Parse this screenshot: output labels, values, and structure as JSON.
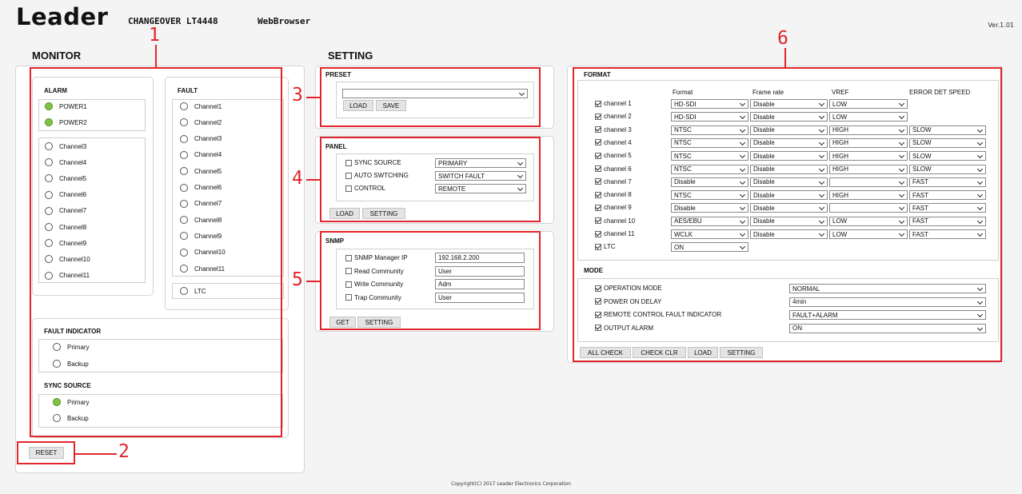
{
  "header": {
    "logo": "Leader",
    "product": "CHANGEOVER LT4448",
    "app": "WebBrowser",
    "version": "Ver.1.01"
  },
  "monitor": {
    "title": "MONITOR",
    "alarm": {
      "title": "ALARM",
      "power": [
        {
          "label": "POWER1",
          "on": true
        },
        {
          "label": "POWER2",
          "on": true
        }
      ],
      "channels": [
        "Channel3",
        "Channel4",
        "Channel5",
        "Channel6",
        "Channel7",
        "Channel8",
        "Channel9",
        "Channel10",
        "Channel11"
      ]
    },
    "fault": {
      "title": "FAULT",
      "channels": [
        "Channel1",
        "Channel2",
        "Channel3",
        "Channel4",
        "Channel5",
        "Channel6",
        "Channel7",
        "Channel8",
        "Channel9",
        "Channel10",
        "Channel11"
      ],
      "ltc": "LTC"
    },
    "fault_indicator": {
      "title": "FAULT INDICATOR",
      "items": [
        {
          "label": "Primary",
          "on": false
        },
        {
          "label": "Backup",
          "on": false
        }
      ]
    },
    "sync_source": {
      "title": "SYNC SOURCE",
      "items": [
        {
          "label": "Primary",
          "on": true
        },
        {
          "label": "Backup",
          "on": false
        }
      ]
    },
    "reset": "RESET"
  },
  "setting": {
    "title": "SETTING",
    "preset": {
      "title": "PRESET",
      "value": "",
      "load": "LOAD",
      "save": "SAVE"
    },
    "panel": {
      "title": "PANEL",
      "rows": [
        {
          "label": "SYNC SOURCE",
          "value": "PRIMARY"
        },
        {
          "label": "AUTO SWTCHING",
          "value": "SWITCH FAULT"
        },
        {
          "label": "CONTROL",
          "value": "REMOTE"
        }
      ],
      "load": "LOAD",
      "setting": "SETTING"
    },
    "snmp": {
      "title": "SNMP",
      "rows": [
        {
          "label": "SNMP Manager IP",
          "value": "192.168.2.200"
        },
        {
          "label": "Read Community",
          "value": "User"
        },
        {
          "label": "Write Community",
          "value": "Adm"
        },
        {
          "label": "Trap Community",
          "value": "User"
        }
      ],
      "get": "GET",
      "setting": "SETTING"
    }
  },
  "format": {
    "title": "FORMAT",
    "columns": [
      "Format",
      "Frame rate",
      "VREF",
      "ERROR DET SPEED"
    ],
    "rows": [
      {
        "label": "channel 1",
        "format": "HD-SDI",
        "frame": "Disable",
        "vref": "LOW",
        "speed": null
      },
      {
        "label": "channel 2",
        "format": "HD-SDI",
        "frame": "Disable",
        "vref": "LOW",
        "speed": null
      },
      {
        "label": "channel 3",
        "format": "NTSC",
        "frame": "Disable",
        "vref": "HIGH",
        "speed": "SLOW"
      },
      {
        "label": "channel 4",
        "format": "NTSC",
        "frame": "Disable",
        "vref": "HIGH",
        "speed": "SLOW"
      },
      {
        "label": "channel 5",
        "format": "NTSC",
        "frame": "Disable",
        "vref": "HIGH",
        "speed": "SLOW"
      },
      {
        "label": "channel 6",
        "format": "NTSC",
        "frame": "Disable",
        "vref": "HIGH",
        "speed": "SLOW"
      },
      {
        "label": "channel 7",
        "format": "Disable",
        "frame": "Disable",
        "vref": "",
        "speed": "FAST"
      },
      {
        "label": "channel 8",
        "format": "NTSC",
        "frame": "Disable",
        "vref": "HIGH",
        "speed": "FAST"
      },
      {
        "label": "channel 9",
        "format": "Disable",
        "frame": "Disable",
        "vref": "",
        "speed": "FAST"
      },
      {
        "label": "channel 10",
        "format": "AES/EBU",
        "frame": "Disable",
        "vref": "LOW",
        "speed": "FAST"
      },
      {
        "label": "channel 11",
        "format": "WCLK",
        "frame": "Disable",
        "vref": "LOW",
        "speed": "FAST"
      },
      {
        "label": "LTC",
        "format": "ON",
        "frame": null,
        "vref": null,
        "speed": null
      }
    ]
  },
  "mode": {
    "title": "MODE",
    "rows": [
      {
        "label": "OPERATION MODE",
        "value": "NORMAL"
      },
      {
        "label": "POWER ON DELAY",
        "value": "4min"
      },
      {
        "label": "REMOTE CONTROL FAULT INDICATOR",
        "value": "FAULT+ALARM"
      },
      {
        "label": "OUTPUT ALARM",
        "value": "ON"
      }
    ],
    "buttons": [
      "ALL CHECK",
      "CHECK CLR",
      "LOAD",
      "SETTING"
    ]
  },
  "callouts": [
    "1",
    "2",
    "3",
    "4",
    "5",
    "6"
  ],
  "footer": "Copyright(C) 2017 Leader Electronics Corporation"
}
